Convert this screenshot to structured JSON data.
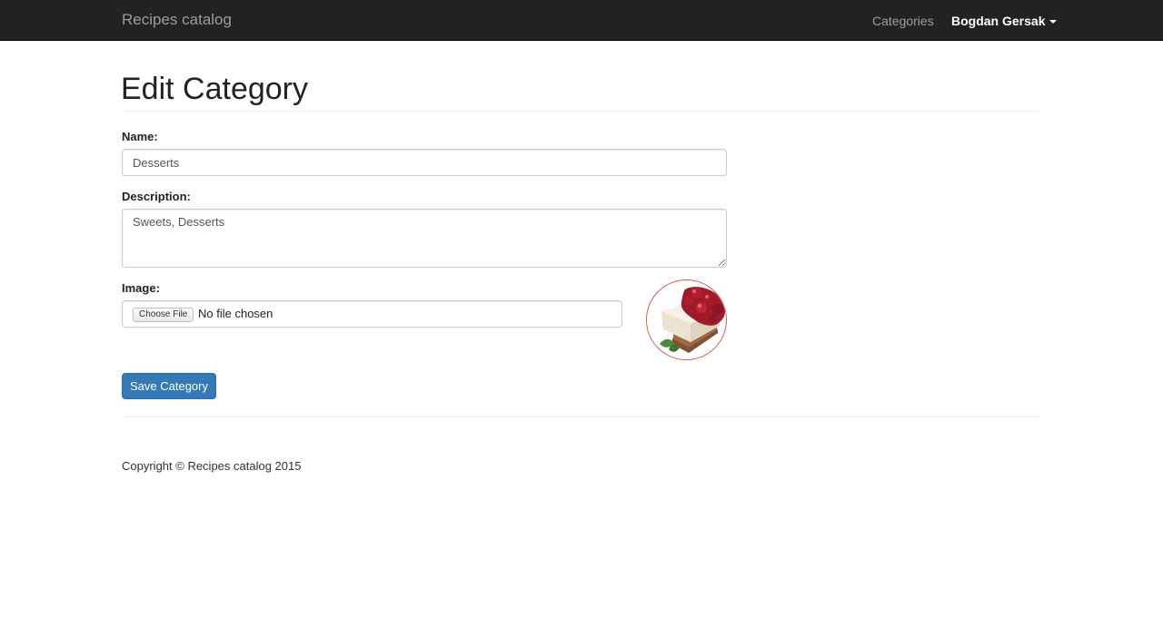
{
  "navbar": {
    "brand": "Recipes catalog",
    "categories_link": "Categories",
    "user_name": "Bogdan Gersak",
    "background": "#222222"
  },
  "page": {
    "title": "Edit Category"
  },
  "form": {
    "name_label": "Name:",
    "name_value": "Desserts",
    "description_label": "Description:",
    "description_value": "Sweets, Desserts",
    "image_label": "Image:",
    "file_button_label": "Choose File",
    "file_status": "No file chosen",
    "image_alt": "cheesecake-image",
    "save_label": "Save Category",
    "accent": "#337ab7"
  },
  "footer": {
    "copyright": "Copyright © Recipes catalog 2015"
  }
}
